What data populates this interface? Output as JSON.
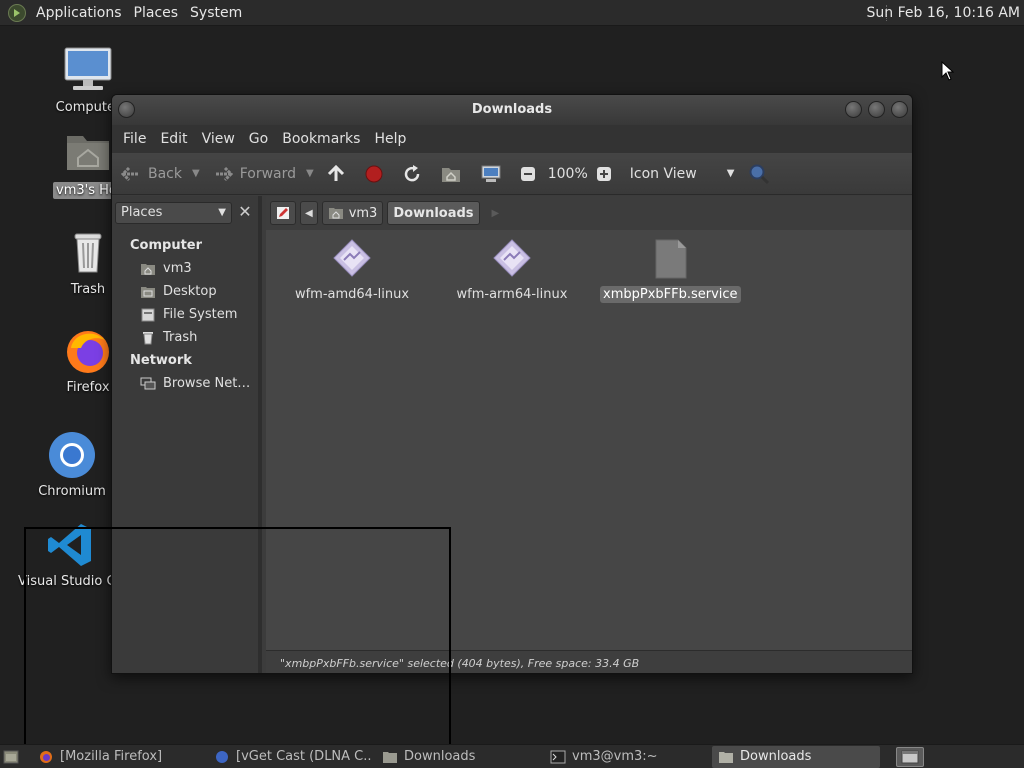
{
  "top_panel": {
    "menus": [
      "Applications",
      "Places",
      "System"
    ],
    "clock": "Sun Feb 16, 10:16 AM"
  },
  "desktop": {
    "icons": [
      {
        "label": "Computer",
        "icon": "computer-icon"
      },
      {
        "label": "vm3's Home",
        "icon": "home-folder-icon",
        "selected": true
      },
      {
        "label": "Trash",
        "icon": "trash-icon"
      },
      {
        "label": "Firefox",
        "icon": "firefox-icon"
      },
      {
        "label": "Chromium",
        "icon": "chromium-icon"
      },
      {
        "label": "Visual Studio Code",
        "icon": "vscode-icon"
      }
    ]
  },
  "window": {
    "title": "Downloads",
    "menu": [
      "File",
      "Edit",
      "View",
      "Go",
      "Bookmarks",
      "Help"
    ],
    "toolbar": {
      "back": "Back",
      "forward": "Forward",
      "zoom": "100%",
      "view_mode": "Icon View"
    },
    "sidebar": {
      "combo": "Places",
      "sections": [
        {
          "title": "Computer",
          "items": [
            {
              "label": "vm3",
              "icon": "home-icon"
            },
            {
              "label": "Desktop",
              "icon": "desktop-icon"
            },
            {
              "label": "File System",
              "icon": "filesystem-icon"
            },
            {
              "label": "Trash",
              "icon": "trash-icon"
            }
          ]
        },
        {
          "title": "Network",
          "items": [
            {
              "label": "Browse Net…",
              "icon": "network-icon"
            }
          ]
        }
      ]
    },
    "pathbar": [
      "vm3",
      "Downloads"
    ],
    "files": [
      {
        "name": "wfm-amd64-linux",
        "icon": "executable-icon"
      },
      {
        "name": "wfm-arm64-linux",
        "icon": "executable-icon"
      },
      {
        "name": "xmbpPxbFFb.service",
        "icon": "text-file-icon",
        "selected": true
      }
    ],
    "status": "\"xmbpPxbFFb.service\" selected (404 bytes), Free space: 33.4 GB"
  },
  "taskbar": {
    "tasks": [
      {
        "label": "[Mozilla Firefox]",
        "icon": "firefox-icon"
      },
      {
        "label": "[vGet Cast (DLNA C...",
        "icon": "vget-icon"
      },
      {
        "label": "Downloads",
        "icon": "folder-icon"
      },
      {
        "label": "vm3@vm3:~",
        "icon": "terminal-icon"
      },
      {
        "label": "Downloads",
        "icon": "folder-icon",
        "active": true
      }
    ]
  }
}
